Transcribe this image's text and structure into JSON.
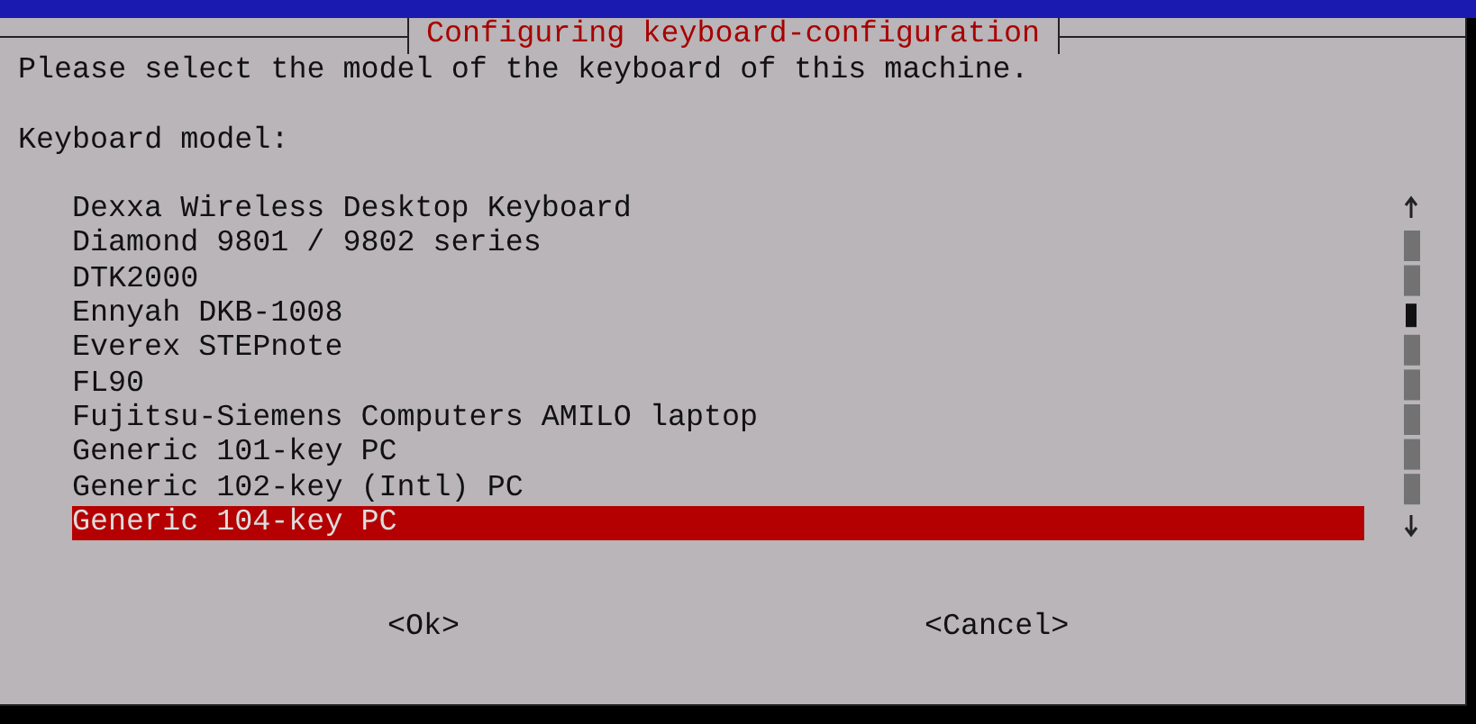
{
  "dialog": {
    "title": "Configuring keyboard-configuration",
    "prompt": "Please select the model of the keyboard of this machine.",
    "list_label": "Keyboard model:",
    "items": [
      {
        "label": "Dexxa Wireless Desktop Keyboard",
        "selected": false
      },
      {
        "label": "Diamond 9801 / 9802 series",
        "selected": false
      },
      {
        "label": "DTK2000",
        "selected": false
      },
      {
        "label": "Ennyah DKB-1008",
        "selected": false
      },
      {
        "label": "Everex STEPnote",
        "selected": false
      },
      {
        "label": "FL90",
        "selected": false
      },
      {
        "label": "Fujitsu-Siemens Computers AMILO laptop",
        "selected": false
      },
      {
        "label": "Generic 101-key PC",
        "selected": false
      },
      {
        "label": "Generic 102-key (Intl) PC",
        "selected": false
      },
      {
        "label": "Generic 104-key PC",
        "selected": true
      }
    ],
    "buttons": [
      "<Ok>",
      "<Cancel>"
    ]
  }
}
